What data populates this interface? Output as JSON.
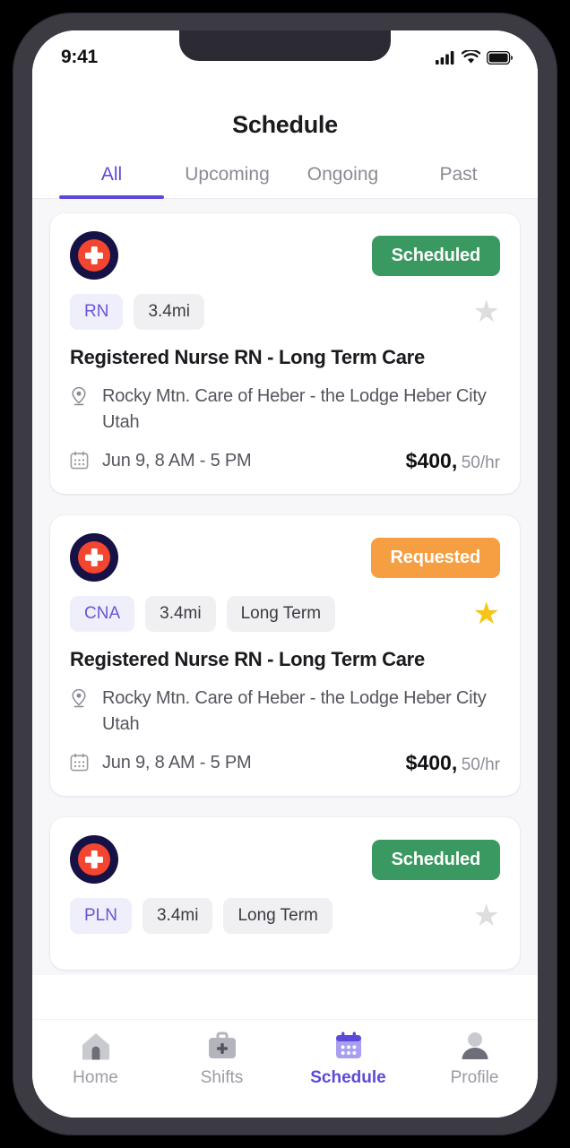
{
  "status_bar": {
    "time": "9:41",
    "icons": [
      "signal-icon",
      "wifi-icon",
      "battery-icon"
    ]
  },
  "header": {
    "title": "Schedule"
  },
  "tabs": [
    {
      "label": "All",
      "active": true
    },
    {
      "label": "Upcoming",
      "active": false
    },
    {
      "label": "Ongoing",
      "active": false
    },
    {
      "label": "Past",
      "active": false
    }
  ],
  "colors": {
    "accent": "#5b4ad9",
    "scheduled": "#3a9960",
    "requested": "#f69e42",
    "star_filled": "#f5c518",
    "star_empty": "#dedede",
    "logo_outer": "#171246",
    "logo_inner": "#f4452f"
  },
  "cards": [
    {
      "status": "Scheduled",
      "status_type": "scheduled",
      "tags": [
        "RN",
        "3.4mi"
      ],
      "favorite": false,
      "title": "Registered Nurse RN - Long Term Care",
      "location": "Rocky Mtn. Care of Heber - the Lodge Heber City Utah",
      "date": "Jun 9, 8 AM - 5 PM",
      "price_main": "$400,",
      "price_sub": "50/hr"
    },
    {
      "status": "Requested",
      "status_type": "requested",
      "tags": [
        "CNA",
        "3.4mi",
        "Long Term"
      ],
      "favorite": true,
      "title": "Registered Nurse RN - Long Term Care",
      "location": "Rocky Mtn. Care of Heber - the Lodge Heber City Utah",
      "date": "Jun 9, 8 AM - 5 PM",
      "price_main": "$400,",
      "price_sub": "50/hr"
    },
    {
      "status": "Scheduled",
      "status_type": "scheduled",
      "tags": [
        "PLN",
        "3.4mi",
        "Long Term"
      ],
      "favorite": false,
      "title": "",
      "location": "",
      "date": "",
      "price_main": "",
      "price_sub": ""
    }
  ],
  "bottom_nav": [
    {
      "label": "Home",
      "icon": "home-icon",
      "active": false
    },
    {
      "label": "Shifts",
      "icon": "medical-bag-icon",
      "active": false
    },
    {
      "label": "Schedule",
      "icon": "calendar-icon",
      "active": true
    },
    {
      "label": "Profile",
      "icon": "person-icon",
      "active": false
    }
  ]
}
